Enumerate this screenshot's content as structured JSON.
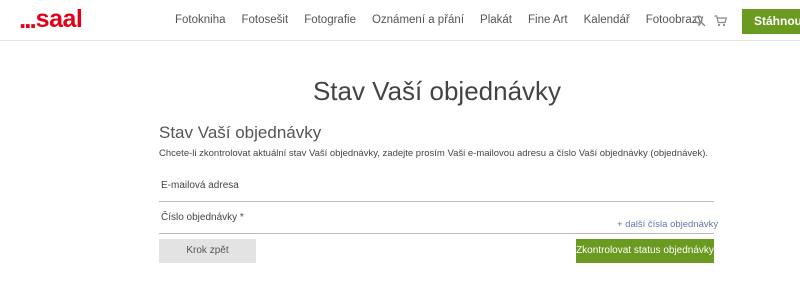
{
  "header": {
    "logo_dots": "...",
    "logo_text": "saal",
    "nav": [
      "Fotokniha",
      "Fotosešit",
      "Fotografie",
      "Oznámení a přání",
      "Plakát",
      "Fine Art",
      "Kalendář",
      "Fotoobrazy"
    ],
    "icons": [
      "search-icon",
      "cart-icon"
    ],
    "download_label": "Stáhnout"
  },
  "main": {
    "page_title": "Stav Vaší objednávky",
    "form_title": "Stav Vaší objednávky",
    "intro": "Chcete-li zkontrolovat aktuální stav Vaší objednávky, zadejte prosím Vaši e-mailovou adresu a číslo Vaší objednávky (objednávek).",
    "email_label": "E-mailová adresa",
    "order_label": "Číslo objednávky *",
    "add_more_label": "+ další čísla objednávky",
    "back_label": "Krok zpět",
    "check_label": "Zkontrolovat status objednávky"
  },
  "colors": {
    "brand": "#e2001a",
    "accent": "#6a9a1f",
    "link": "#6678a8"
  }
}
